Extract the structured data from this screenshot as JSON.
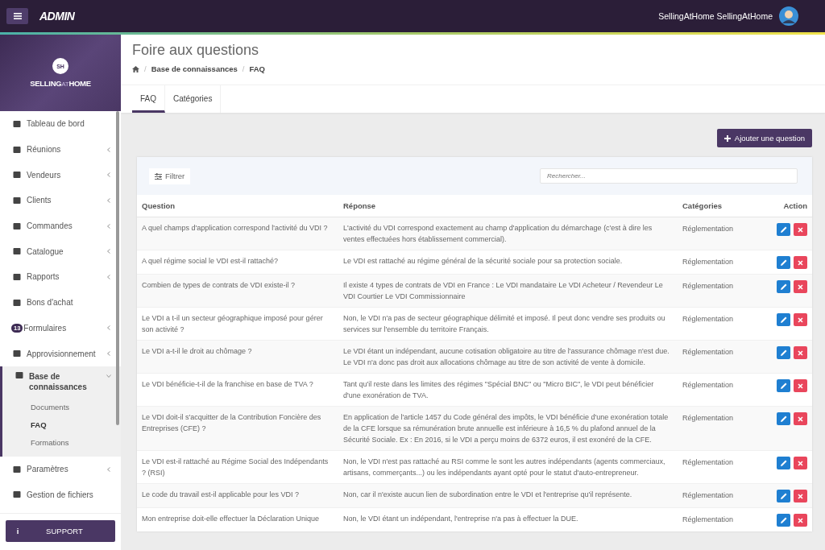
{
  "topbar": {
    "brand": "ADMIN",
    "user": "SellingAtHome SellingAtHome"
  },
  "sidebar": {
    "logo_initials": "SH",
    "logo_text": "SELLING",
    "logo_mid": "AT",
    "logo_end": "HOME",
    "items": [
      {
        "label": "Tableau de bord",
        "expandable": false,
        "expanded": false
      },
      {
        "label": "Réunions",
        "expandable": true,
        "expanded": false
      },
      {
        "label": "Vendeurs",
        "expandable": true,
        "expanded": false
      },
      {
        "label": "Clients",
        "expandable": true,
        "expanded": false
      },
      {
        "label": "Commandes",
        "expandable": true,
        "expanded": false
      },
      {
        "label": "Catalogue",
        "expandable": true,
        "expanded": false
      },
      {
        "label": "Rapports",
        "expandable": true,
        "expanded": false
      },
      {
        "label": "Bons d'achat",
        "expandable": false,
        "expanded": false
      },
      {
        "label": "Formulaires",
        "badge": "13",
        "expandable": true,
        "expanded": false
      },
      {
        "label": "Approvisionnement",
        "expandable": true,
        "expanded": false
      },
      {
        "label": "Base de connaissances",
        "expandable": true,
        "expanded": true,
        "children": [
          {
            "label": "Documents",
            "selected": false
          },
          {
            "label": "FAQ",
            "selected": true
          },
          {
            "label": "Formations",
            "selected": false
          }
        ]
      },
      {
        "label": "Paramètres",
        "expandable": true,
        "expanded": false
      },
      {
        "label": "Gestion de fichiers",
        "expandable": false,
        "expanded": false
      }
    ],
    "support": {
      "icon": "i",
      "label": "SUPPORT"
    }
  },
  "page": {
    "title": "Foire aux questions",
    "breadcrumb": [
      {
        "separator": "/",
        "label": "Base de connaissances"
      },
      {
        "separator": "/",
        "label": "FAQ"
      }
    ]
  },
  "tabs": [
    {
      "label": "FAQ",
      "selected": true
    },
    {
      "label": "Catégories",
      "selected": false
    }
  ],
  "add_button": "Ajouter une question",
  "filter_button": "Filtrer",
  "search": {
    "placeholder": "Rechercher..."
  },
  "table": {
    "columns": [
      "Question",
      "Réponse",
      "Catégories",
      "Action"
    ],
    "rows": [
      {
        "question": "A quel champs d'application correspond l'activité du VDI ?",
        "answer": "L'activité du VDI correspond exactement au champ d'application du démarchage (c'est à dire les ventes effectuées hors établissement commercial).",
        "category": "Réglementation"
      },
      {
        "question": "A quel régime social le VDI est-il rattaché?",
        "answer": "Le VDI est rattaché au régime général de la sécurité sociale pour sa protection sociale.",
        "category": "Réglementation"
      },
      {
        "question": "Combien de types de contrats de VDI existe-il ?",
        "answer": "Il existe 4 types de contrats de VDI en France : Le VDI mandataire Le VDI Acheteur / Revendeur Le VDI Courtier Le VDI Commissionnaire",
        "category": "Réglementation"
      },
      {
        "question": "Le VDI a t-il un secteur géographique imposé pour gérer son activité ?",
        "answer": "Non, le VDI n'a pas de secteur géographique délimité et imposé. Il peut donc vendre ses produits ou services sur l'ensemble du territoire Français.",
        "category": "Réglementation"
      },
      {
        "question": "Le VDI a-t-il le droit au chômage ?",
        "answer": "Le VDI étant un indépendant, aucune cotisation obligatoire au titre de l'assurance chômage n'est due. Le VDI n'a donc pas droit aux allocations chômage au titre de son activité de vente à domicile.",
        "category": "Réglementation"
      },
      {
        "question": "Le VDI bénéficie-t-il de la franchise en base de TVA ?",
        "answer": "Tant qu'il reste dans les limites des régimes \"Spécial BNC\" ou \"Micro BIC\", le VDI peut bénéficier d'une exonération de TVA.",
        "category": "Réglementation"
      },
      {
        "question": "Le VDI doit-il s'acquitter de la Contribution Foncière des Entreprises (CFE) ?",
        "answer": "En application de l'article 1457 du Code général des impôts, le VDI bénéficie d'une exonération totale de la CFE lorsque sa rémunération brute annuelle est inférieure à 16,5 % du plafond annuel de la Sécurité Sociale. Ex : En 2016, si le VDI a perçu moins de 6372 euros, il est exonéré de la CFE.",
        "category": "Réglementation"
      },
      {
        "question": "Le VDI est-il rattaché au Régime Social des Indépendants ? (RSI)",
        "answer": "Non, le VDI n'est pas rattaché au RSI comme le sont les autres indépendants (agents commerciaux, artisans, commerçants...) ou les indépendants ayant opté pour le statut d'auto-entrepreneur.",
        "category": "Réglementation"
      },
      {
        "question": "Le code du travail est-il applicable pour les VDI ?",
        "answer": "Non, car il n'existe aucun lien de subordination entre le VDI et l'entreprise qu'il représente.",
        "category": "Réglementation"
      },
      {
        "question": "Mon entreprise doit-elle effectuer la Déclaration Unique",
        "answer": "Non, le VDI étant un indépendant, l'entreprise n'a pas à effectuer la DUE.",
        "category": "Réglementation"
      }
    ]
  }
}
